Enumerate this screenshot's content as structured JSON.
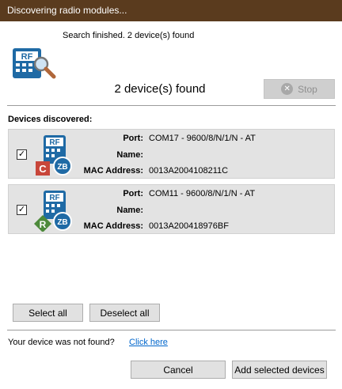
{
  "window": {
    "title": "Discovering radio modules..."
  },
  "status": {
    "message": "Search finished. 2 device(s) found",
    "found_text": "2 device(s) found",
    "stop_label": "Stop"
  },
  "devices_heading": "Devices discovered:",
  "labels": {
    "port": "Port:",
    "name": "Name:",
    "mac": "MAC Address:"
  },
  "devices": [
    {
      "checked": true,
      "role_badge": "C",
      "protocol_badge": "ZB",
      "icon_text": "RF",
      "port": "COM17 - 9600/8/N/1/N - AT",
      "name": "",
      "mac": "0013A2004108211C"
    },
    {
      "checked": true,
      "role_badge": "R",
      "protocol_badge": "ZB",
      "icon_text": "RF",
      "port": "COM11 - 9600/8/N/1/N - AT",
      "name": "",
      "mac": "0013A200418976BF"
    }
  ],
  "buttons": {
    "select_all": "Select all",
    "deselect_all": "Deselect all",
    "cancel": "Cancel",
    "add_selected": "Add selected devices"
  },
  "footer": {
    "not_found": "Your device was not found?",
    "click_here": "Click here"
  },
  "colors": {
    "titlebar": "#5a3b1e",
    "module_blue": "#1f6aa5",
    "coordinator_red": "#c8463a",
    "router_green": "#4d8a3b",
    "link": "#0066cc"
  }
}
